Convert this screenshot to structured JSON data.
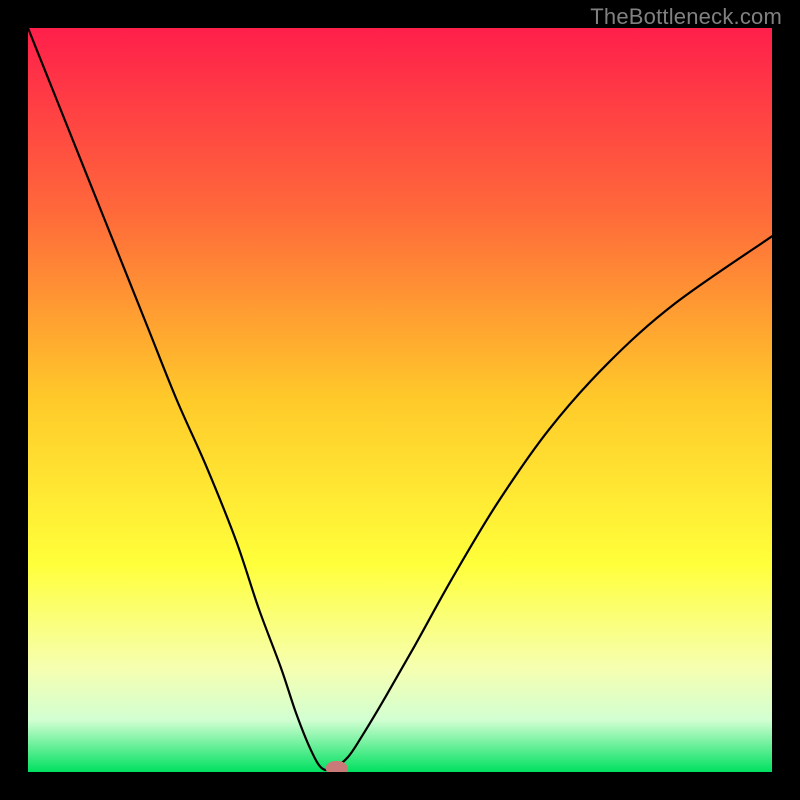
{
  "watermark": "TheBottleneck.com",
  "chart_data": {
    "type": "line",
    "title": "",
    "xlabel": "",
    "ylabel": "",
    "xlim": [
      0,
      100
    ],
    "ylim": [
      0,
      100
    ],
    "background_gradient": {
      "stops": [
        {
          "offset": 0,
          "color": "#ff1f4b"
        },
        {
          "offset": 25,
          "color": "#ff6a3a"
        },
        {
          "offset": 50,
          "color": "#ffca2a"
        },
        {
          "offset": 72,
          "color": "#ffff3a"
        },
        {
          "offset": 86,
          "color": "#f6ffb0"
        },
        {
          "offset": 93,
          "color": "#d2ffd2"
        },
        {
          "offset": 100,
          "color": "#00e060"
        }
      ]
    },
    "series": [
      {
        "name": "bottleneck-curve",
        "color": "#000000",
        "x": [
          0,
          4,
          8,
          12,
          16,
          20,
          24,
          28,
          31,
          34,
          36,
          38,
          39.5,
          41,
          43,
          45,
          48,
          52,
          57,
          63,
          70,
          78,
          87,
          100
        ],
        "y": [
          100,
          90,
          80,
          70,
          60,
          50,
          41,
          31,
          22,
          14,
          8,
          3,
          0.5,
          0.5,
          2,
          5,
          10,
          17,
          26,
          36,
          46,
          55,
          63,
          72
        ]
      }
    ],
    "marker": {
      "name": "current-point",
      "x": 41.5,
      "y": 0.5,
      "rx": 1.5,
      "ry": 1.0,
      "fill": "#c97a78"
    },
    "annotations": []
  }
}
